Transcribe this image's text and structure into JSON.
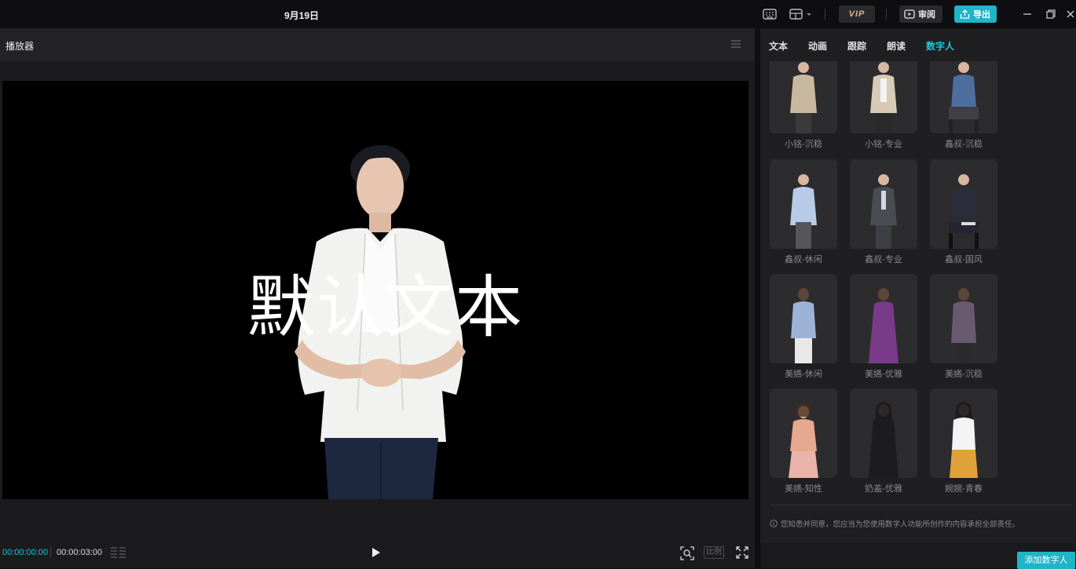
{
  "window": {
    "title": "9月19日"
  },
  "toolbar": {
    "vip_label": "VIP",
    "review_label": "审阅",
    "export_label": "导出"
  },
  "player": {
    "title": "播放器",
    "overlay_text": "默认文本",
    "time_current": "00:00:00:00",
    "time_total": "00:00:03:00",
    "ratio_label": "比例"
  },
  "side": {
    "tabs": [
      {
        "label": "文本"
      },
      {
        "label": "动画"
      },
      {
        "label": "跟踪"
      },
      {
        "label": "朗读"
      },
      {
        "label": "数字人"
      }
    ],
    "active_tab": "数字人",
    "avatars": [
      {
        "label": "小铭-沉稳"
      },
      {
        "label": "小铭-专业"
      },
      {
        "label": "鑫叔-沉稳"
      },
      {
        "label": "鑫叔-休闲"
      },
      {
        "label": "鑫叔-专业"
      },
      {
        "label": "鑫叔-国风"
      },
      {
        "label": "美嬿-休闲"
      },
      {
        "label": "美嬿-优雅"
      },
      {
        "label": "美嬿-沉稳"
      },
      {
        "label": "美嬿-知性"
      },
      {
        "label": "奶盖-优雅"
      },
      {
        "label": "婉婉-青春"
      }
    ],
    "disclaimer": "您知悉并同意，您应当为您使用数字人功能所创作的内容承担全部责任。",
    "add_button": "添加数字人"
  },
  "colors": {
    "accent": "#1fb4c6",
    "active_tab": "#1fc6d8",
    "timecode": "#19c0d4"
  }
}
